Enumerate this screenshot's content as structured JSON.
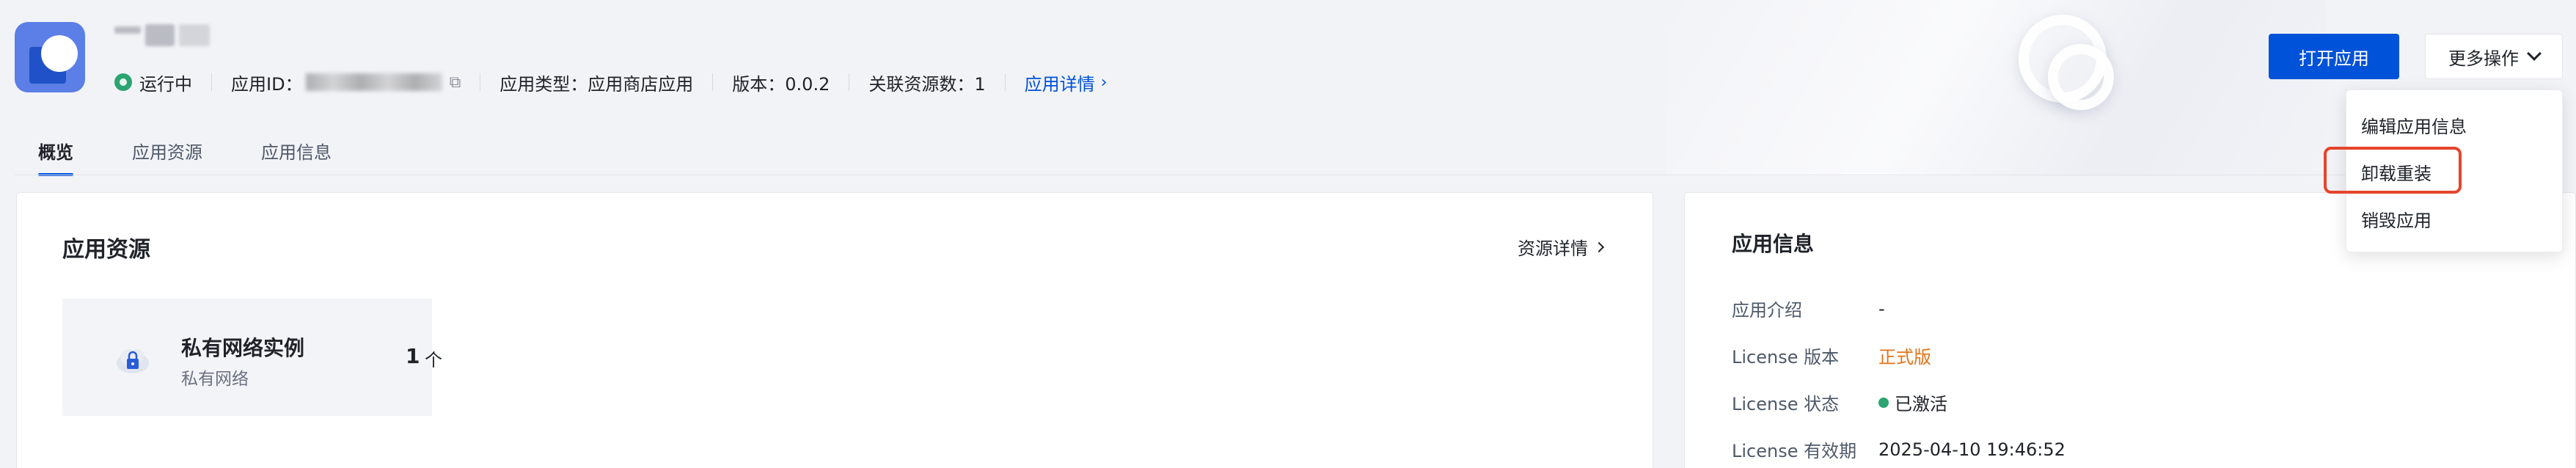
{
  "header": {
    "app_name_visible": "",
    "status": "运行中",
    "app_id_label": "应用ID：",
    "app_type": "应用类型：应用商店应用",
    "version": "版本：0.0.2",
    "linked_resources": "关联资源数：1",
    "detail_link": "应用详情",
    "open_button": "打开应用",
    "more_button": "更多操作"
  },
  "tabs": [
    {
      "label": "概览",
      "active": true
    },
    {
      "label": "应用资源",
      "active": false
    },
    {
      "label": "应用信息",
      "active": false
    }
  ],
  "resources_card": {
    "title": "应用资源",
    "detail_link": "资源详情",
    "tile": {
      "name": "私有网络实例",
      "subtitle": "私有网络",
      "count": "1",
      "unit": "个"
    }
  },
  "info_card": {
    "title": "应用信息",
    "rows": [
      {
        "label": "应用介绍",
        "value": "-"
      },
      {
        "label": "License 版本",
        "value": "正式版"
      },
      {
        "label": "License 状态",
        "value": "已激活"
      },
      {
        "label": "License 有效期",
        "value": "2025-04-10 19:46:52"
      }
    ]
  },
  "dropdown": {
    "items": [
      "编辑应用信息",
      "卸载重装",
      "销毁应用"
    ]
  },
  "colors": {
    "primary": "#0052d9",
    "success": "#2ba471",
    "warning": "#e37318",
    "highlight": "#e5452c"
  }
}
